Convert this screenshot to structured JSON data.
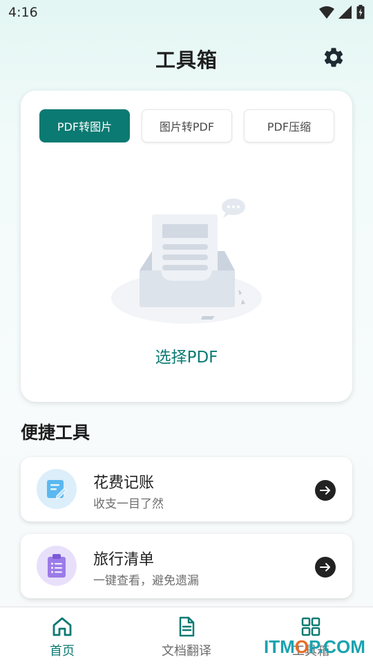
{
  "status_bar": {
    "time": "4:16"
  },
  "header": {
    "title": "工具箱"
  },
  "pdf_tabs": [
    {
      "label": "PDF转图片",
      "active": true
    },
    {
      "label": "图片转PDF",
      "active": false
    },
    {
      "label": "PDF压缩",
      "active": false
    }
  ],
  "main_card": {
    "select_label": "选择PDF"
  },
  "section": {
    "title": "便捷工具"
  },
  "tools": [
    {
      "name": "花费记账",
      "subtitle": "收支一目了然",
      "icon": "note-pencil-icon"
    },
    {
      "name": "旅行清单",
      "subtitle": "一键查看，避免遗漏",
      "icon": "clipboard-list-icon"
    }
  ],
  "bottom_nav": [
    {
      "label": "首页",
      "icon": "home-icon",
      "active": true
    },
    {
      "label": "文档翻译",
      "icon": "document-icon",
      "active": false
    },
    {
      "label": "工具箱",
      "icon": "grid-icon",
      "active": false
    }
  ],
  "watermark": {
    "prefix": "IT",
    "mid": "M",
    "o": "O",
    "suffix": "P.COM"
  },
  "colors": {
    "accent": "#0b7a72",
    "background": "#eef9f7"
  }
}
